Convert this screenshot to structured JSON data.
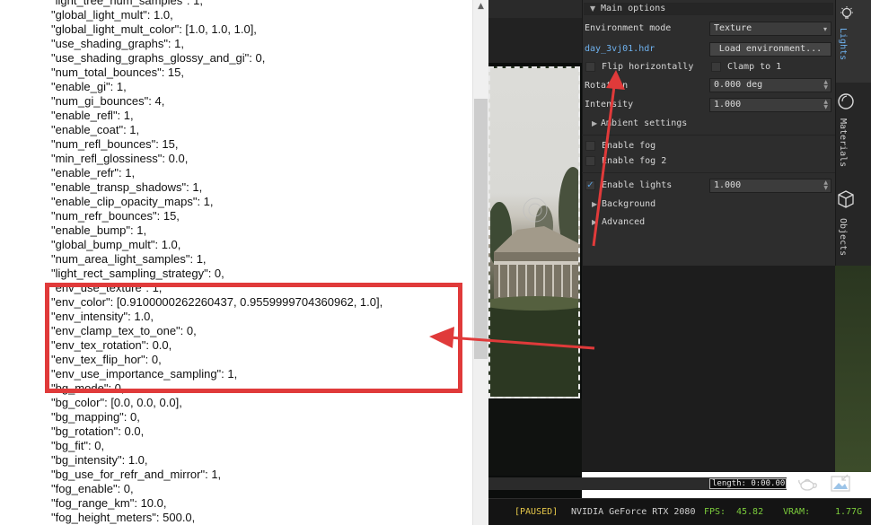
{
  "editor": {
    "lines": [
      "\"light_tree_num_samples\": 1,",
      "\"global_light_mult\": 1.0,",
      "\"global_light_mult_color\": [1.0, 1.0, 1.0],",
      "\"use_shading_graphs\": 1,",
      "\"use_shading_graphs_glossy_and_gi\": 0,",
      "\"num_total_bounces\": 15,",
      "\"enable_gi\": 1,",
      "\"num_gi_bounces\": 4,",
      "\"enable_refl\": 1,",
      "\"enable_coat\": 1,",
      "\"num_refl_bounces\": 15,",
      "\"min_refl_glossiness\": 0.0,",
      "\"enable_refr\": 1,",
      "\"enable_transp_shadows\": 1,",
      "\"enable_clip_opacity_maps\": 1,",
      "\"num_refr_bounces\": 15,",
      "\"enable_bump\": 1,",
      "\"global_bump_mult\": 1.0,",
      "\"num_area_light_samples\": 1,",
      "\"light_rect_sampling_strategy\": 0,",
      "\"env_use_texture\": 1,",
      "\"env_color\": [0.9100000262260437, 0.9559999704360962, 1.0],",
      "\"env_intensity\": 1.0,",
      "\"env_clamp_tex_to_one\": 0,",
      "\"env_tex_rotation\": 0.0,",
      "\"env_tex_flip_hor\": 0,",
      "\"env_use_importance_sampling\": 1,",
      "\"bg_mode\": 0,",
      "\"bg_color\": [0.0, 0.0, 0.0],",
      "\"bg_mapping\": 0,",
      "\"bg_rotation\": 0.0,",
      "\"bg_fit\": 0,",
      "\"bg_intensity\": 1.0,",
      "\"bg_use_for_refr_and_mirror\": 1,",
      "\"fog_enable\": 0,",
      "\"fog_range_km\": 10.0,",
      "\"fog_height_meters\": 500.0,"
    ]
  },
  "panel": {
    "section_title": "Main options",
    "env_mode_label": "Environment mode",
    "env_mode_value": "Texture",
    "env_file": "day_3vj01.hdr",
    "load_env_button": "Load environment...",
    "flip_label": "Flip horizontally",
    "clamp_label": "Clamp to 1",
    "rotation_label": "Rotation",
    "rotation_value": "0.000 deg",
    "intensity_label": "Intensity",
    "intensity_value": "1.000",
    "ambient_label": "Ambient settings",
    "fog_label": "Enable fog",
    "fog2_label": "Enable fog 2",
    "lights_label": "Enable lights",
    "lights_value": "1.000",
    "background_label": "Background",
    "advanced_label": "Advanced"
  },
  "tabs": [
    "Lights",
    "Materials",
    "Objects"
  ],
  "viewport": {
    "length_label": "length: 0:00.00"
  },
  "status": {
    "paused": "[PAUSED]",
    "gpu": "NVIDIA GeForce RTX 2080",
    "fps_label": "FPS:",
    "fps_value": "45.82",
    "vram_label": "VRAM:",
    "vram_value": "1.77G"
  },
  "colors": {
    "highlight": "#e03a3a",
    "accent": "#6fb2ef",
    "status_green": "#7ccd3c",
    "paused": "#e6c84a"
  }
}
